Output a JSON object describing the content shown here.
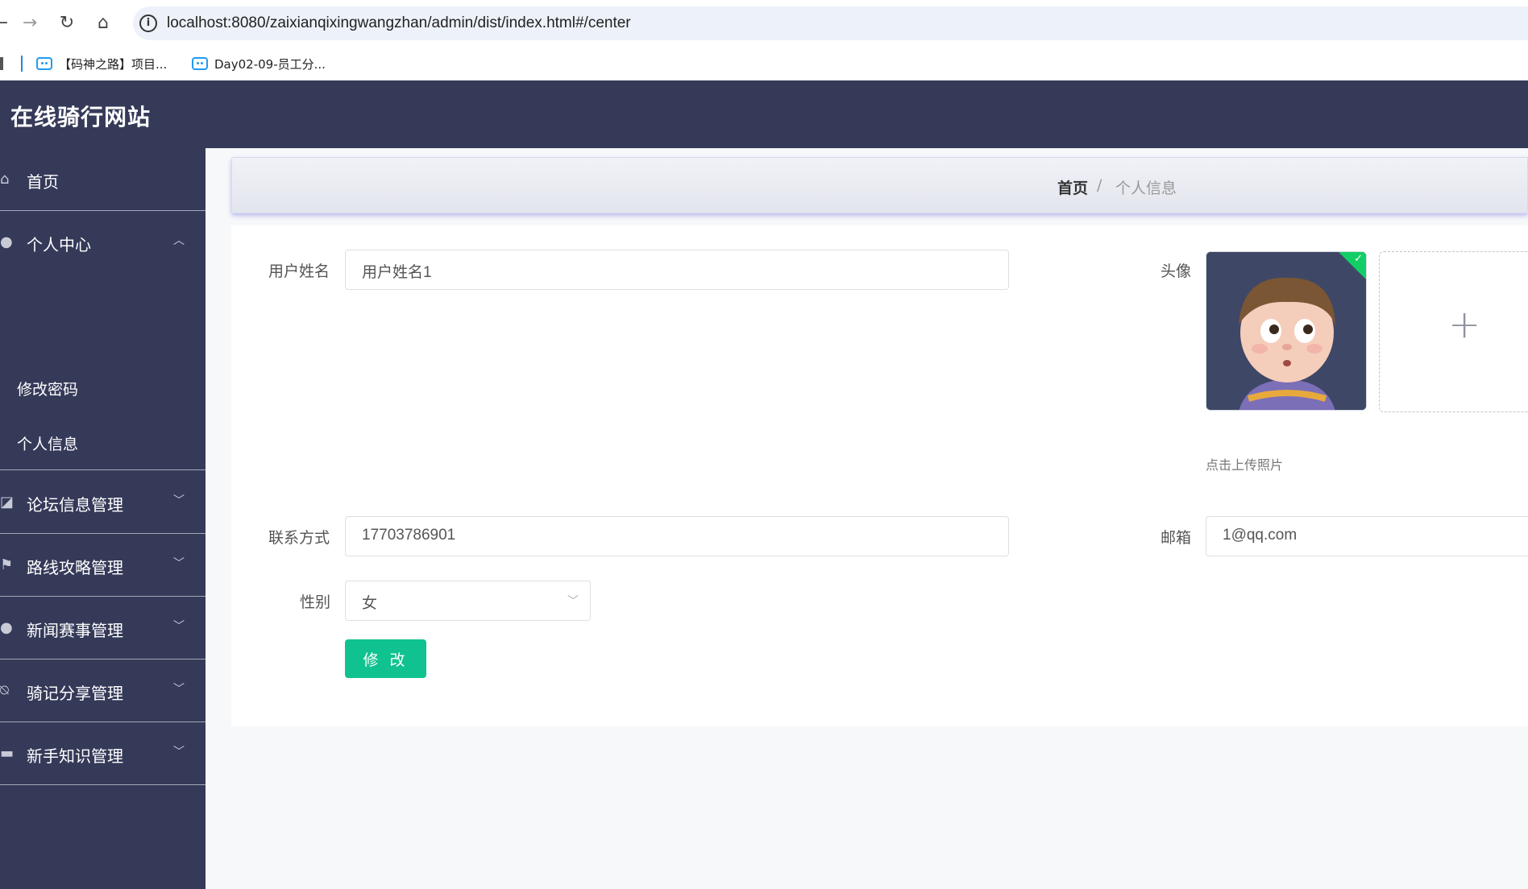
{
  "browser": {
    "url": "localhost:8080/zaixianqixingwangzhan/admin/dist/index.html#/center",
    "bookmarks": [
      "【码神之路】项目...",
      "Day02-09-员工分..."
    ]
  },
  "app": {
    "title": "在线骑行网站"
  },
  "sidebar": {
    "items": [
      {
        "label": "首页",
        "icon": "home-icon"
      },
      {
        "label": "个人中心",
        "icon": "user-icon"
      },
      {
        "label": "论坛信息管理",
        "icon": "chart-icon"
      },
      {
        "label": "路线攻略管理",
        "icon": "flag-icon"
      },
      {
        "label": "新闻赛事管理",
        "icon": "user-icon"
      },
      {
        "label": "骑记分享管理",
        "icon": "bell-off-icon"
      },
      {
        "label": "新手知识管理",
        "icon": "monitor-icon"
      }
    ],
    "submenu": [
      "修改密码",
      "个人信息"
    ]
  },
  "breadcrumb": {
    "home": "首页",
    "separator": "/",
    "current": "个人信息"
  },
  "form": {
    "username": {
      "label": "用户姓名",
      "value": "用户姓名1"
    },
    "avatar": {
      "label": "头像",
      "tip": "点击上传照片"
    },
    "phone": {
      "label": "联系方式",
      "value": "17703786901"
    },
    "email": {
      "label": "邮箱",
      "value": "1@qq.com"
    },
    "gender": {
      "label": "性别",
      "value": "女"
    },
    "submit_label": "修 改"
  },
  "colors": {
    "header": "#353a59",
    "accent": "#10c28f"
  }
}
